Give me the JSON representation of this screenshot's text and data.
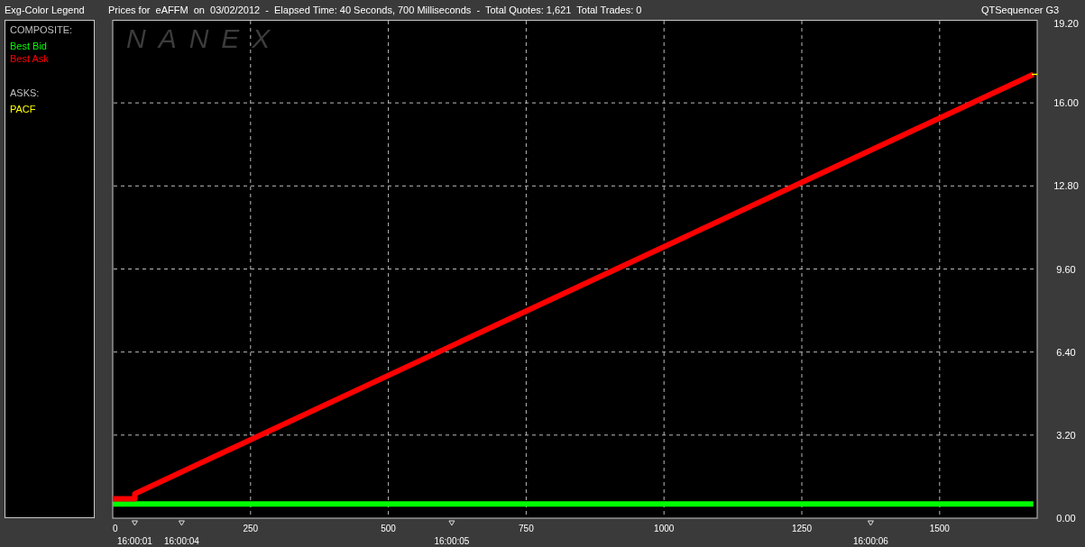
{
  "legend": {
    "title": "Exg-Color Legend",
    "groups": [
      {
        "heading": "COMPOSITE:"
      },
      {
        "heading": "ASKS:",
        "items": [
          {
            "label": "PACF",
            "color": "#ffff00"
          }
        ]
      }
    ]
  },
  "header": {
    "title": "Prices for  eAFFM  on  03/02/2012  -  Elapsed Time: 40 Seconds, 700 Milliseconds  -  Total Quotes: 1,621  Total Trades: 0",
    "app_name": "QTSequencer G3"
  },
  "watermark_logo": "NANEX",
  "chart_data": {
    "type": "line",
    "grid": true,
    "x": [
      0,
      40,
      40,
      1670
    ],
    "series": [
      {
        "name": "Best Bid",
        "color": "#00ff00",
        "values": [
          0.55,
          0.55,
          0.55,
          0.55
        ]
      },
      {
        "name": "Best Ask",
        "color": "#ff0000",
        "values": [
          0.75,
          0.75,
          0.94,
          17.1
        ]
      }
    ],
    "xlim": [
      0,
      1677
    ],
    "ylim": [
      0,
      19.2
    ],
    "xticks": [
      0,
      250,
      500,
      750,
      1000,
      1250,
      1500
    ],
    "yticks": [
      {
        "value": 0,
        "label": "0.00"
      },
      {
        "value": 3.2,
        "label": "3.20"
      },
      {
        "value": 6.4,
        "label": "6.40"
      },
      {
        "value": 9.6,
        "label": "9.60"
      },
      {
        "value": 12.8,
        "label": "12.80"
      },
      {
        "value": 16,
        "label": "16.00"
      },
      {
        "value": 19.2,
        "label": "19.20"
      }
    ],
    "annotations": [
      "16:00:01",
      "16:00:04",
      "16:00:05",
      "16:00:06"
    ]
  }
}
